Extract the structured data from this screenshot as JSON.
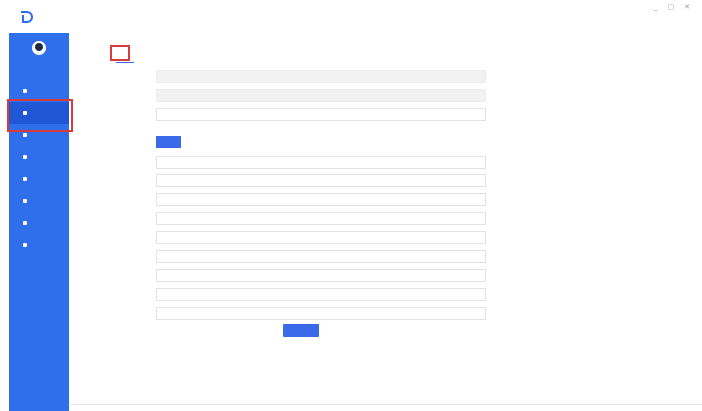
{
  "header": {
    "logo_text": "",
    "system_title": "",
    "user_menu": "",
    "window_controls": "_ ▢ ✕"
  },
  "sidebar": {
    "username": "",
    "items": [
      {
        "label": ""
      },
      {
        "label": "",
        "active": true
      },
      {
        "label": ""
      },
      {
        "label": ""
      },
      {
        "label": ""
      },
      {
        "label": ""
      },
      {
        "label": ""
      },
      {
        "label": ""
      }
    ]
  },
  "tabs": [
    {
      "label": "",
      "active": true
    },
    {
      "label": ""
    },
    {
      "label": ""
    }
  ],
  "form": {
    "fields": [
      {
        "label": "",
        "value": "",
        "readonly": true
      },
      {
        "label": "",
        "value": "",
        "readonly": true
      },
      {
        "label": "",
        "value": "",
        "readonly": false
      },
      {
        "label": "",
        "button": "",
        "type": "button"
      },
      {
        "label": "",
        "value": "",
        "readonly": false
      },
      {
        "label": "",
        "value": "",
        "readonly": false
      },
      {
        "label": "",
        "value": "",
        "readonly": false
      },
      {
        "label": "",
        "value": "",
        "readonly": false
      },
      {
        "label": "",
        "value": "",
        "readonly": false
      },
      {
        "label": "",
        "value": "",
        "readonly": false
      },
      {
        "label": "",
        "value": "",
        "readonly": false
      },
      {
        "label": "",
        "value": "",
        "readonly": false
      },
      {
        "label": "",
        "value": "",
        "readonly": false
      }
    ],
    "save_label": ""
  },
  "colors": {
    "sidebar_bg": "#2f6fec",
    "sidebar_active": "#1f57d4",
    "accent": "#3b6ae8",
    "highlight_box": "#d83b3b"
  }
}
